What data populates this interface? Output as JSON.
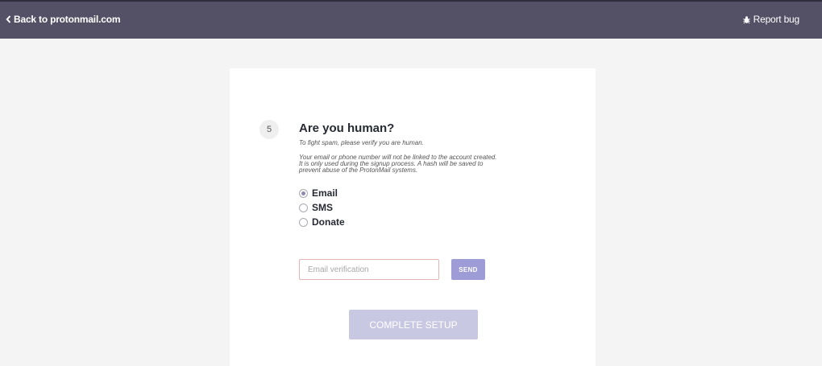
{
  "header": {
    "back_label": "Back to protonmail.com",
    "back_icon": "chevron-left-icon",
    "report_label": "Report bug",
    "report_icon": "bug-icon"
  },
  "step": {
    "number": "5",
    "title": "Are you human?",
    "subtitle": "To fight spam, please verify you are human.",
    "notice_lines": [
      "Your email or phone number will not be linked to the account created.",
      "It is only used during the signup process. A hash will be saved to",
      "prevent abuse of the ProtonMail systems."
    ]
  },
  "verification_options": [
    {
      "label": "Email",
      "selected": true
    },
    {
      "label": "SMS",
      "selected": false
    },
    {
      "label": "Donate",
      "selected": false
    }
  ],
  "email_verification": {
    "placeholder": "Email verification",
    "value": "",
    "send_label": "SEND"
  },
  "complete_label": "COMPLETE SETUP",
  "colors": {
    "header_bg": "#545065",
    "accent": "#9d9cd6",
    "button_disabled": "#c9c8e3",
    "input_error_border": "#e3b4b4"
  }
}
